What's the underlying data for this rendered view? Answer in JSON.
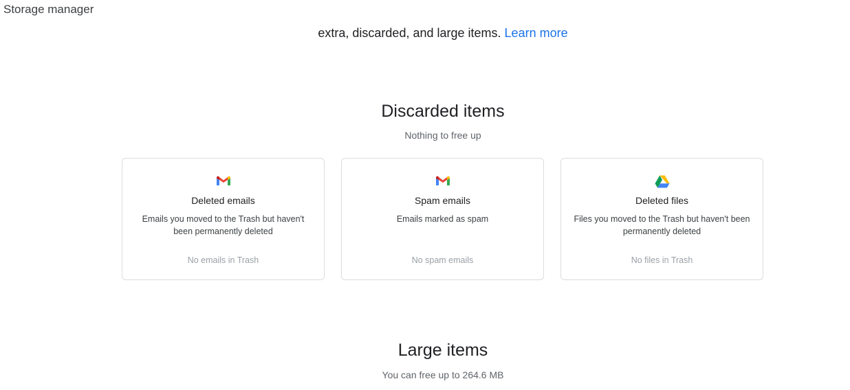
{
  "app": {
    "title": "Storage manager"
  },
  "intro": {
    "text": "extra, discarded, and large items.",
    "link_label": "Learn more"
  },
  "discarded": {
    "title": "Discarded items",
    "subtitle": "Nothing to free up",
    "cards": [
      {
        "icon": "gmail-icon",
        "title": "Deleted emails",
        "description": "Emails you moved to the Trash but haven't been permanently deleted",
        "status": "No emails in Trash"
      },
      {
        "icon": "gmail-icon",
        "title": "Spam emails",
        "description": "Emails marked as spam",
        "status": "No spam emails"
      },
      {
        "icon": "google-drive-icon",
        "title": "Deleted files",
        "description": "Files you moved to the Trash but haven't been permanently deleted",
        "status": "No files in Trash"
      }
    ]
  },
  "large": {
    "title": "Large items",
    "subtitle": "You can free up to 264.6 MB"
  },
  "colors": {
    "link": "#1a73e8",
    "border": "#dadce0",
    "muted": "#9aa0a6"
  }
}
